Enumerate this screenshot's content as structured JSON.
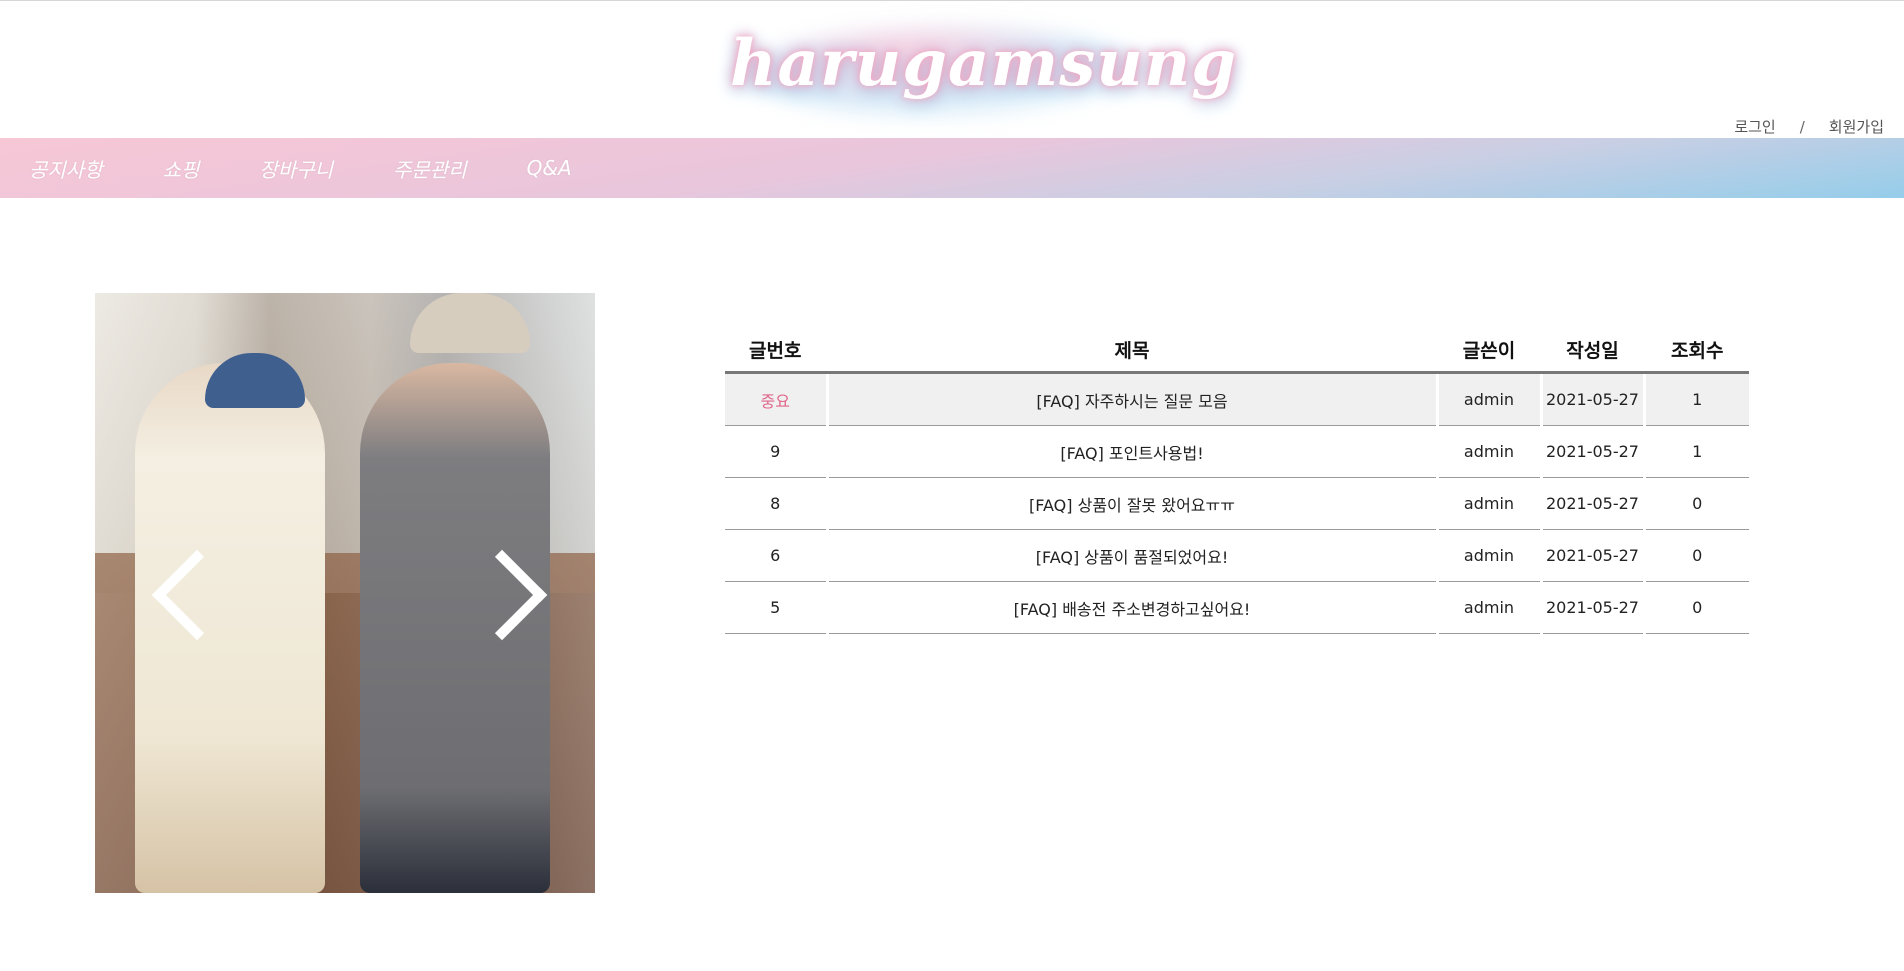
{
  "header": {
    "logo": "harugamsung",
    "auth": {
      "login": "로그인",
      "separator": "/",
      "signup": "회원가입"
    }
  },
  "nav": {
    "items": [
      "공지사항",
      "쇼핑",
      "장바구니",
      "주문관리",
      "Q&A"
    ]
  },
  "slider": {
    "prev_icon": "chevron-left-icon",
    "next_icon": "chevron-right-icon"
  },
  "board": {
    "columns": [
      "글번호",
      "제목",
      "글쓴이",
      "작성일",
      "조회수"
    ],
    "rows": [
      {
        "no": "중요",
        "title": "[FAQ] 자주하시는 질문 모음",
        "author": "admin",
        "date": "2021-05-27",
        "views": "1"
      },
      {
        "no": "9",
        "title": "[FAQ] 포인트사용법!",
        "author": "admin",
        "date": "2021-05-27",
        "views": "1"
      },
      {
        "no": "8",
        "title": "[FAQ] 상품이 잘못 왔어요ㅠㅠ",
        "author": "admin",
        "date": "2021-05-27",
        "views": "0"
      },
      {
        "no": "6",
        "title": "[FAQ] 상품이 품절되었어요!",
        "author": "admin",
        "date": "2021-05-27",
        "views": "0"
      },
      {
        "no": "5",
        "title": "[FAQ] 배송전 주소변경하고싶어요!",
        "author": "admin",
        "date": "2021-05-27",
        "views": "0"
      }
    ]
  },
  "colors": {
    "nav_gradient_start": "#f7c7d5",
    "nav_gradient_end": "#95cdea",
    "important": "#e0668a"
  }
}
